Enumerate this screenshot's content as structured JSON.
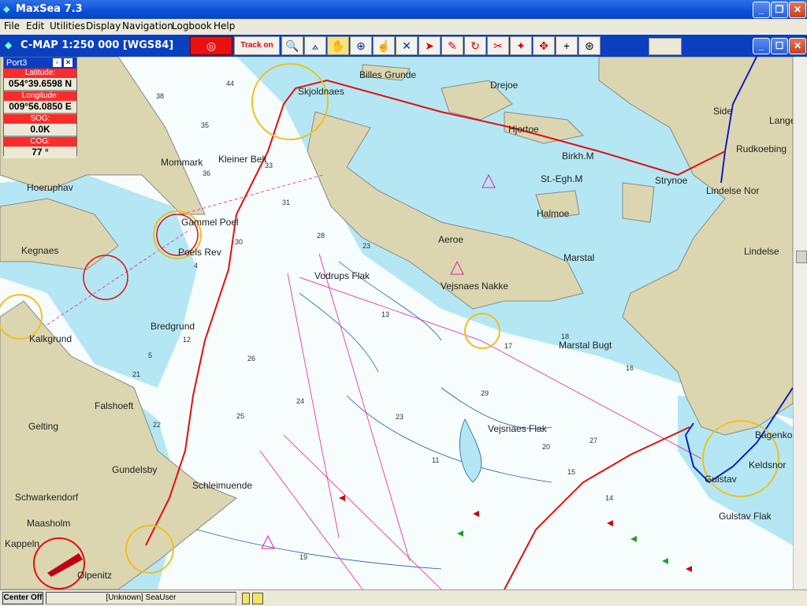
{
  "app": {
    "title": "MaxSea 7.3"
  },
  "menu": [
    "File",
    "Edit",
    "Utilities",
    "Display",
    "Navigation",
    "Logbook",
    "Help"
  ],
  "chart": {
    "scale_label": "C-MAP  1:250 000 [WGS84]"
  },
  "toolbar": {
    "track_label": "Track on"
  },
  "port": {
    "title": "Port3",
    "lat_label": "Latitude:",
    "lat": "054°39.6598 N",
    "lon_label": "Longitude:",
    "lon": "009°56.0850 E",
    "sog_label": "SOG:",
    "sog": "0.0K",
    "cog_label": "COG:",
    "cog": "77 °"
  },
  "places": [
    {
      "name": "Billes Grunde"
    },
    {
      "name": "Skjoldnaes"
    },
    {
      "name": "Drejoe"
    },
    {
      "name": "Hjortoe"
    },
    {
      "name": "Birkh.M"
    },
    {
      "name": "St.-Egh.M"
    },
    {
      "name": "Side"
    },
    {
      "name": "Lange"
    },
    {
      "name": "Rudkoebing"
    },
    {
      "name": "Lindelse Nor"
    },
    {
      "name": "Strynoe"
    },
    {
      "name": "Halmoe"
    },
    {
      "name": "Lindelse"
    },
    {
      "name": "Mommark"
    },
    {
      "name": "Kleiner Belt"
    },
    {
      "name": "Hoeruphav"
    },
    {
      "name": "Aeroe"
    },
    {
      "name": "Marstal"
    },
    {
      "name": "Gammel Poel"
    },
    {
      "name": "Poels Rev"
    },
    {
      "name": "Kegnaes"
    },
    {
      "name": "Vodrups Flak"
    },
    {
      "name": "Vejsnaes Nakke"
    },
    {
      "name": "Bredgrund"
    },
    {
      "name": "Kalkgrund"
    },
    {
      "name": "Marstal Bugt"
    },
    {
      "name": "Falshoeft"
    },
    {
      "name": "Vejsnaes Flak"
    },
    {
      "name": "Gelting"
    },
    {
      "name": "Bagenko"
    },
    {
      "name": "Keldsnor"
    },
    {
      "name": "Gundelsby"
    },
    {
      "name": "Schleimuende"
    },
    {
      "name": "Gulstav"
    },
    {
      "name": "Schwarkendorf"
    },
    {
      "name": "Gulstav Flak"
    },
    {
      "name": "Maasholm"
    },
    {
      "name": "Kappeln"
    },
    {
      "name": "Olpenitz"
    }
  ],
  "depths": [
    "44",
    "38",
    "35",
    "36",
    "33",
    "31",
    "28",
    "23",
    "30",
    "18",
    "4",
    "5",
    "13",
    "16",
    "26",
    "21",
    "24",
    "23",
    "12",
    "15",
    "17",
    "20",
    "19",
    "22",
    "25",
    "27",
    "29",
    "11",
    "14"
  ],
  "status": {
    "center": "Center Off",
    "user": "[Unknown] SeaUser"
  }
}
